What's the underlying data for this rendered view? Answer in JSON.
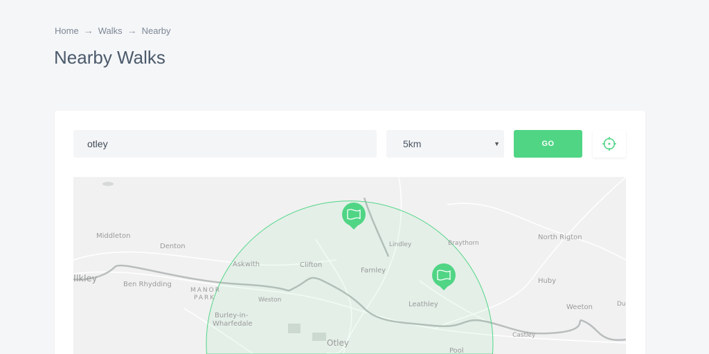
{
  "breadcrumb": [
    "Home",
    "Walks",
    "Nearby"
  ],
  "breadcrumb_separator": "→",
  "title": "Nearby Walks",
  "search": {
    "value": "otley"
  },
  "radius": {
    "selected": "5km"
  },
  "go_label": "GO",
  "accent": "#50d585",
  "map": {
    "places": [
      "Middleton",
      "Denton",
      "Askwith",
      "Clifton",
      "Farnley",
      "Lindley",
      "Braythorn",
      "North Rigton",
      "Ilkley",
      "Ben Rhydding",
      "MANOR",
      "PARK",
      "Weston",
      "Leathley",
      "Huby",
      "Weeton",
      "Burley-in-",
      "Wharfedale",
      "Otley",
      "Castley",
      "Pool",
      "Du"
    ]
  }
}
